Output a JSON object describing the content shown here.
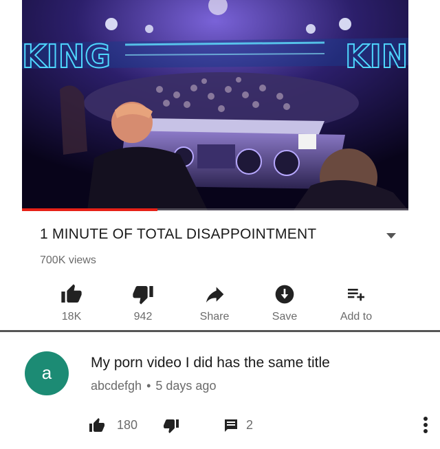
{
  "video": {
    "neon_sign": "KING",
    "progress_fraction": 0.35,
    "title": "1 MINUTE OF TOTAL DISAPPOINTMENT",
    "views": "700K views"
  },
  "actions": [
    {
      "icon": "thumbs-up-icon",
      "label": "18K"
    },
    {
      "icon": "thumbs-down-icon",
      "label": "942"
    },
    {
      "icon": "share-icon",
      "label": "Share"
    },
    {
      "icon": "save-icon",
      "label": "Save"
    },
    {
      "icon": "add-to-playlist-icon",
      "label": "Add to"
    }
  ],
  "comment": {
    "avatar_letter": "a",
    "avatar_color": "#1c8b74",
    "text": "My porn video I did has the same title",
    "author": "abcdefgh",
    "separator": "•",
    "time": "5 days ago",
    "likes": "180",
    "replies": "2"
  },
  "colors": {
    "text_primary": "#1a1a1a",
    "text_secondary": "#6b6b6b",
    "progress": "#e62117",
    "icon": "#222222"
  }
}
